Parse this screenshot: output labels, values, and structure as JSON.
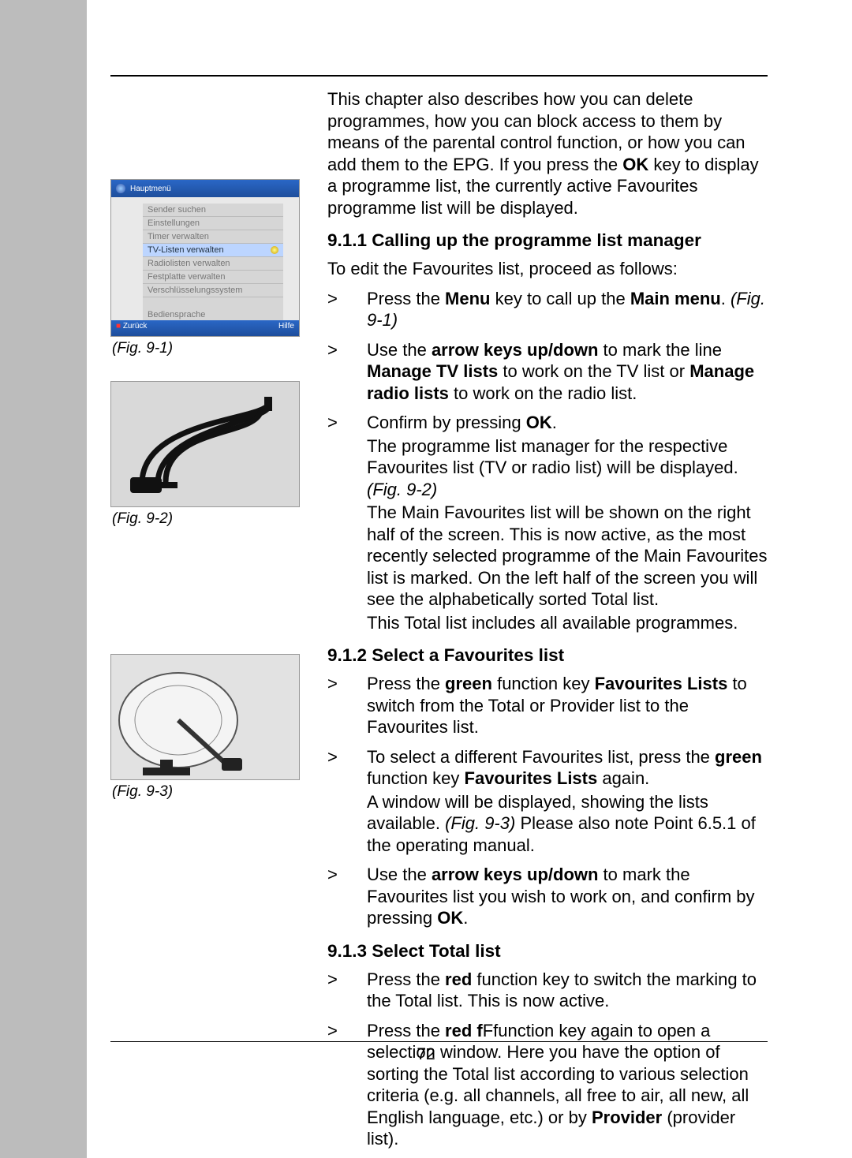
{
  "intro": {
    "p1a": "This chapter also describes how you can delete programmes, how you can block access to them by means of the parental control function, or how you can add them to the EPG. If you press the ",
    "p1b": "OK",
    "p1c": " key to display a programme list, the currently active Favourites programme list will be displayed."
  },
  "sec911": {
    "heading": "9.1.1 Calling up the programme list manager",
    "lead": "To edit the Favourites list, proceed as follows:",
    "step1": {
      "a": "Press the ",
      "b": "Menu",
      "c": " key to call up the ",
      "d": "Main menu",
      "e": ". ",
      "f": "(Fig. 9-1)"
    },
    "step2": {
      "a": "Use the ",
      "b": "arrow keys up/down",
      "c": " to mark the line ",
      "d": "Manage TV lists",
      "e": " to work on the TV list or ",
      "f": "Manage radio lists",
      "g": " to work on the radio list."
    },
    "step3": {
      "a": "Confirm by pressing ",
      "b": "OK",
      "c": ".",
      "d": "The programme list manager for the respective Favourites list (TV or radio list) will be displayed. ",
      "e": "(Fig. 9-2)",
      "f": "The Main Favourites list will be shown on the right half of the screen. This is now active, as the most recently selected programme of the Main Favourites list is marked. On the left half of the screen you will see the alphabetically sorted Total list.",
      "g": "This Total list includes all available programmes."
    }
  },
  "sec912": {
    "heading": "9.1.2 Select a Favourites list",
    "step1": {
      "a": "Press the ",
      "b": "green",
      "c": " function key ",
      "d": "Favourites Lists",
      "e": " to switch from the Total or Provider list to the Favourites list."
    },
    "step2": {
      "a": "To select a different Favourites list, press the ",
      "b": "green",
      "c": " function key ",
      "d": "Favourites Lists",
      "e": " again.",
      "f": "A window will be displayed, showing the lists available. ",
      "g": "(Fig. 9-3)",
      "h": " Please also note Point 6.5.1 of the operating manual."
    },
    "step3": {
      "a": "Use the ",
      "b": "arrow keys up/down",
      "c": " to mark the Favourites list you wish to work on, and confirm by pressing ",
      "d": "OK",
      "e": "."
    }
  },
  "sec913": {
    "heading": "9.1.3 Select Total list",
    "step1": {
      "a": "Press the ",
      "b": "red",
      "c": " function key to switch the marking to the Total list. This is now active."
    },
    "step2": {
      "a": "Press the ",
      "b": "red f",
      "c": "Ffunction key again to open a selection window. Here you have the option of sorting the Total list according to various selection criteria (e.g. all channels, all free to air, all new, all English language, etc.) or by ",
      "d": "Provider",
      "e": " (provider list)."
    }
  },
  "figures": {
    "fig91_caption": "(Fig. 9-1)",
    "fig92_caption": "(Fig. 9-2)",
    "fig93_caption": "(Fig. 9-3)",
    "fig91_title": "Hauptmenü",
    "fig91_items": [
      "Sender suchen",
      "Einstellungen",
      "Timer verwalten",
      "TV-Listen verwalten",
      "Radiolisten verwalten",
      "Festplatte verwalten",
      "Verschlüsselungssystem"
    ],
    "fig91_bedien": "Bediensprache",
    "fig91_back": "Zurück",
    "fig91_help": "Hilfe"
  },
  "page_number": "72"
}
